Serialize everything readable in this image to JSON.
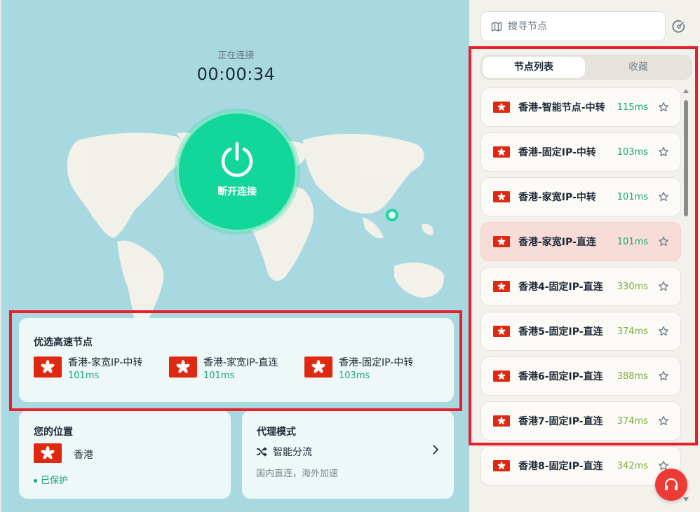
{
  "connection": {
    "status": "正在连接",
    "timer": "00:00:34",
    "button_label": "断开连接"
  },
  "fast_nodes": {
    "title": "优选高速节点",
    "items": [
      {
        "name": "香港-家宽IP-中转",
        "latency": "101ms"
      },
      {
        "name": "香港-家宽IP-直连",
        "latency": "101ms"
      },
      {
        "name": "香港-固定IP-中转",
        "latency": "103ms"
      }
    ]
  },
  "location": {
    "title": "您的位置",
    "region": "香港",
    "status": "已保护"
  },
  "proxy_mode": {
    "title": "代理模式",
    "mode": "智能分流",
    "description": "国内直连，海外加速"
  },
  "search": {
    "placeholder": "搜寻节点"
  },
  "tabs": [
    {
      "label": "节点列表",
      "active": true
    },
    {
      "label": "收藏",
      "active": false
    }
  ],
  "nodes": [
    {
      "name": "香港-智能节点-中转",
      "latency": "115ms",
      "selected": false,
      "color": "#16a873"
    },
    {
      "name": "香港-固定IP-中转",
      "latency": "103ms",
      "selected": false,
      "color": "#16a873"
    },
    {
      "name": "香港-家宽IP-中转",
      "latency": "101ms",
      "selected": false,
      "color": "#16a873"
    },
    {
      "name": "香港-家宽IP-直连",
      "latency": "101ms",
      "selected": true,
      "color": "#16a873"
    },
    {
      "name": "香港4-固定IP-直连",
      "latency": "330ms",
      "selected": false,
      "color": "#7bb03c"
    },
    {
      "name": "香港5-固定IP-直连",
      "latency": "374ms",
      "selected": false,
      "color": "#7bb03c"
    },
    {
      "name": "香港6-固定IP-直连",
      "latency": "388ms",
      "selected": false,
      "color": "#7bb03c"
    },
    {
      "name": "香港7-固定IP-直连",
      "latency": "374ms",
      "selected": false,
      "color": "#7bb03c"
    },
    {
      "name": "香港8-固定IP-直连",
      "latency": "342ms",
      "selected": false,
      "color": "#7bb03c"
    }
  ],
  "colors": {
    "accent": "#12d69a",
    "highlight": "#e8202c",
    "flag_red": "#de2910"
  }
}
